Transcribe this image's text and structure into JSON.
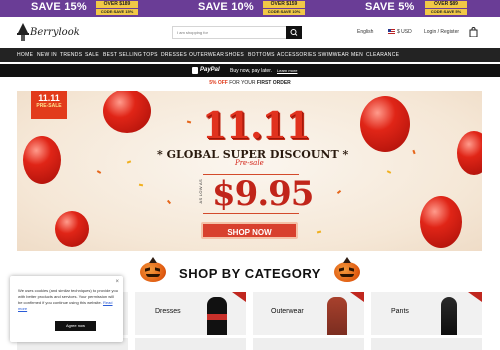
{
  "promo": [
    {
      "save": "SAVE 15%",
      "over": "OVER $189",
      "code": "CODE:SAVE 15%"
    },
    {
      "save": "SAVE 10%",
      "over": "OVER $159",
      "code": "CODE:SAVE 10%"
    },
    {
      "save": "SAVE 5%",
      "over": "OVER $89",
      "code": "CODE:SAVE 5%"
    }
  ],
  "header": {
    "logo_text": "Berrylook",
    "search_placeholder": "I am shopping for",
    "language": "English",
    "currency": "$ USD",
    "account": "Login / Register"
  },
  "nav": [
    "HOME",
    "NEW IN",
    "TRENDS",
    "SALE",
    "BEST SELLING",
    "TOPS",
    "DRESSES",
    "OUTERWEAR",
    "SHOES",
    "BOTTOMS",
    "ACCESSORIES",
    "SWIMWEAR",
    "MEN",
    "CLEARANCE"
  ],
  "paypal": {
    "brand": "PayPal",
    "message": "Buy now, pay later.",
    "link": "Learn more"
  },
  "offer": {
    "pct": "5% OFF",
    "middle": " FOR YOUR ",
    "first": "FIRST ORDER"
  },
  "hero": {
    "badge_top": "11.11",
    "badge_bottom": "PRE-SALE",
    "big": "11.11",
    "headline": "* GLOBAL SUPER DISCOUNT *",
    "script": "Pre-sale",
    "as_low_as": "AS LOW AS",
    "price": "$9.95",
    "cta": "SHOP NOW"
  },
  "section": {
    "title": "SHOP BY CATEGORY"
  },
  "categories": [
    "Dresses",
    "Outerwear",
    "Pants"
  ],
  "cookie": {
    "close": "×",
    "text": "We uses cookies (and similar techniques) to provide you with better products and services. Your permission will be confirmed if you continue using this website.",
    "link": "Read more",
    "agree": "Agree now"
  },
  "colors": {
    "promo_bg": "#6a3d96",
    "promo_chip": "#f1c846",
    "nav_bg": "#232323",
    "accent_red": "#d8402e"
  }
}
